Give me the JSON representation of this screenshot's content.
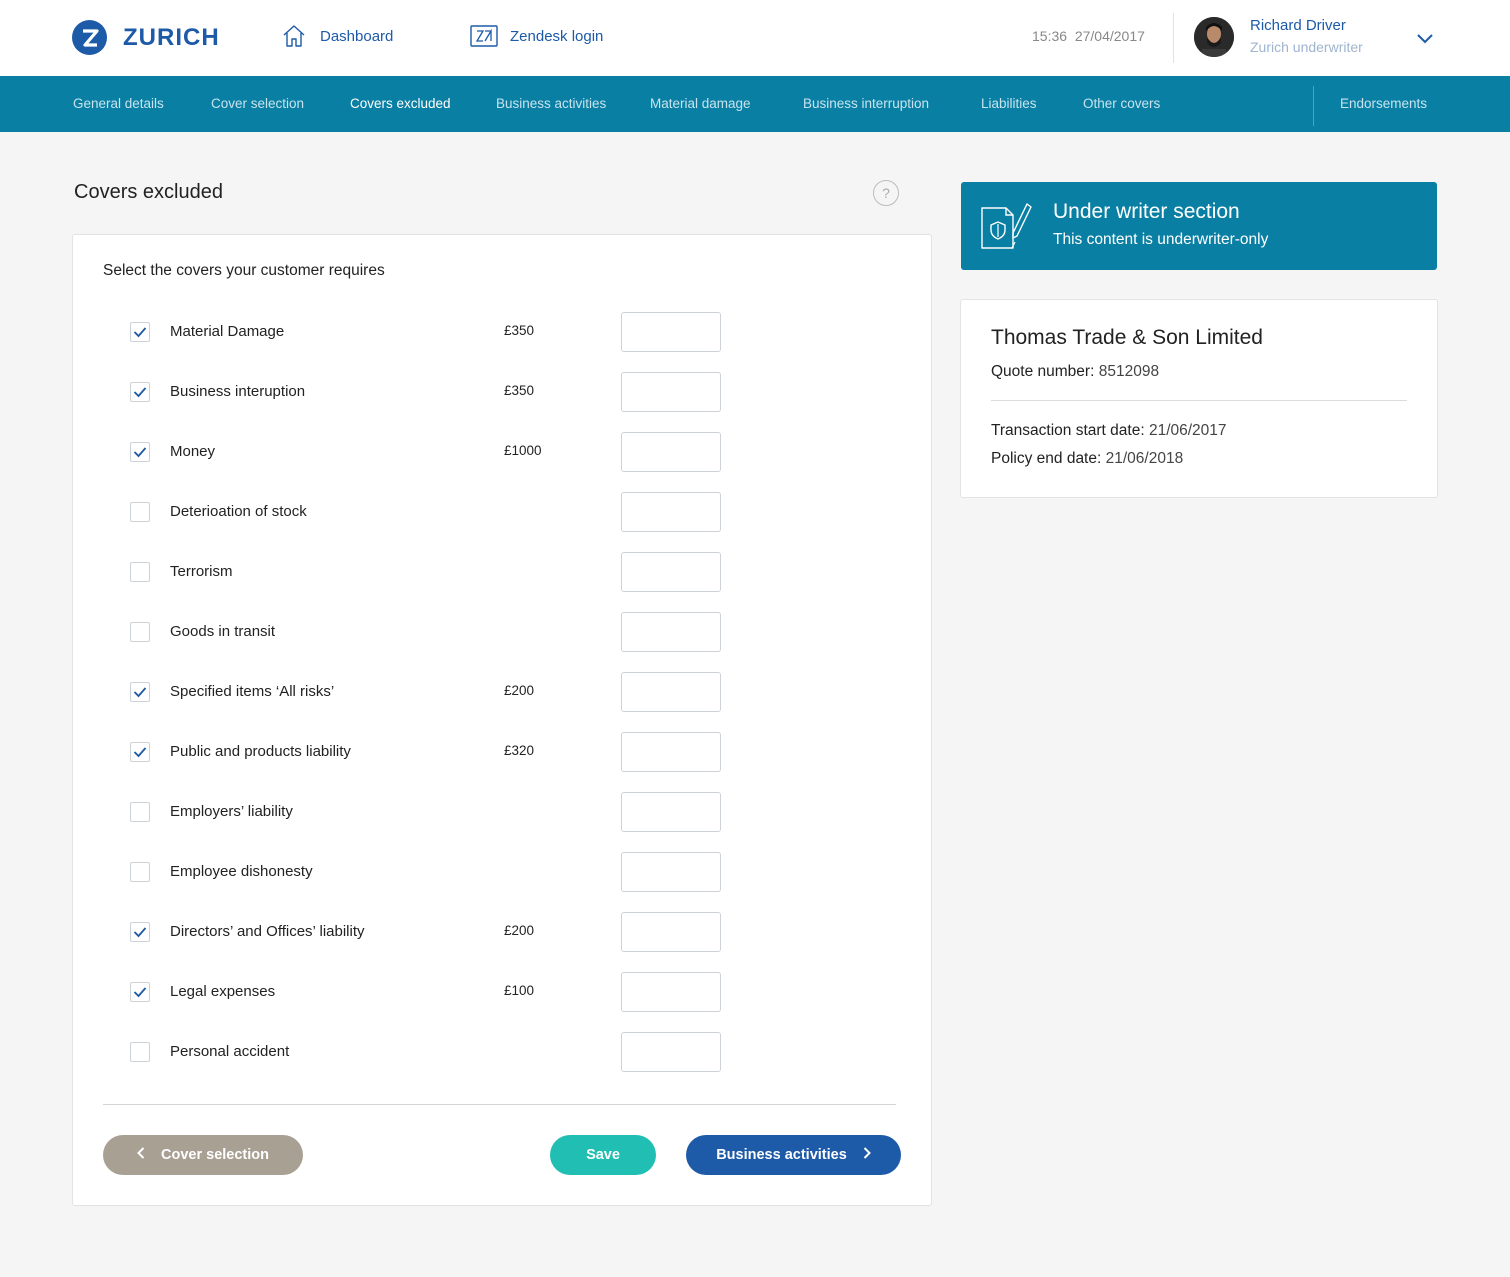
{
  "brand": {
    "name": "ZURICH",
    "color": "#1d5aa8"
  },
  "header": {
    "dashboard_label": "Dashboard",
    "zendesk_label": "Zendesk login",
    "time": "15:36",
    "date": "27/04/2017",
    "user": {
      "name": "Richard Driver",
      "role": "Zurich underwriter"
    }
  },
  "nav": {
    "items": [
      {
        "label": "General details",
        "active": false
      },
      {
        "label": "Cover selection",
        "active": false
      },
      {
        "label": "Covers excluded",
        "active": true
      },
      {
        "label": "Business activities",
        "active": false
      },
      {
        "label": "Material damage",
        "active": false
      },
      {
        "label": "Business interruption",
        "active": false
      },
      {
        "label": "Liabilities",
        "active": false
      },
      {
        "label": "Other covers",
        "active": false
      }
    ],
    "endorsements_label": "Endorsements"
  },
  "page": {
    "title": "Covers excluded",
    "help_label": "?",
    "intro": "Select the covers your customer requires"
  },
  "covers": [
    {
      "label": "Material Damage",
      "checked": true,
      "price": "£350",
      "value": ""
    },
    {
      "label": "Business interuption",
      "checked": true,
      "price": "£350",
      "value": ""
    },
    {
      "label": "Money",
      "checked": true,
      "price": "£1000",
      "value": ""
    },
    {
      "label": "Deterioation of stock",
      "checked": false,
      "price": "",
      "value": ""
    },
    {
      "label": "Terrorism",
      "checked": false,
      "price": "",
      "value": ""
    },
    {
      "label": "Goods in transit",
      "checked": false,
      "price": "",
      "value": ""
    },
    {
      "label": "Specified items ‘All risks’",
      "checked": true,
      "price": "£200",
      "value": ""
    },
    {
      "label": "Public and products liability",
      "checked": true,
      "price": "£320",
      "value": ""
    },
    {
      "label": "Employers’ liability",
      "checked": false,
      "price": "",
      "value": ""
    },
    {
      "label": "Employee dishonesty",
      "checked": false,
      "price": "",
      "value": ""
    },
    {
      "label": "Directors’ and Offices’ liability",
      "checked": true,
      "price": "£200",
      "value": ""
    },
    {
      "label": "Legal expenses",
      "checked": true,
      "price": "£100",
      "value": ""
    },
    {
      "label": "Personal accident",
      "checked": false,
      "price": "",
      "value": ""
    }
  ],
  "actions": {
    "back_label": "Cover selection",
    "save_label": "Save",
    "next_label": "Business activities"
  },
  "underwriter": {
    "title": "Under writer section",
    "subtitle": "This content is underwriter-only"
  },
  "quote": {
    "company": "Thomas Trade & Son Limited",
    "quote_number_label": "Quote number:",
    "quote_number": "8512098",
    "start_label": "Transaction start date:",
    "start_date": "21/06/2017",
    "end_label": "Policy end date:",
    "end_date": "21/06/2018"
  },
  "colors": {
    "nav_bg": "#0a7fa4",
    "primary": "#1d5aa8",
    "save": "#21bfb3",
    "back": "#a9a094"
  }
}
